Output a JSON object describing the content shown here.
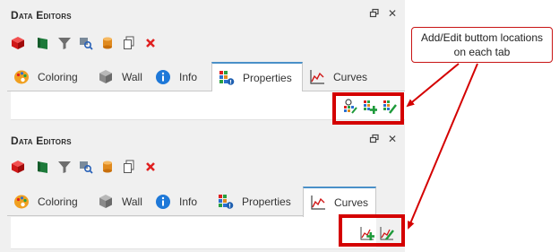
{
  "panels": [
    {
      "title": "Data Editors",
      "tabs": [
        {
          "label": "Coloring",
          "icon": "palette-icon",
          "active": false
        },
        {
          "label": "Wall",
          "icon": "wall-icon",
          "active": false
        },
        {
          "label": "Info",
          "icon": "info-icon",
          "active": false
        },
        {
          "label": "Properties",
          "icon": "properties-icon",
          "active": true
        },
        {
          "label": "Curves",
          "icon": "curves-icon",
          "active": false
        }
      ],
      "tab_tools": [
        "properties-search-icon",
        "properties-add-icon",
        "properties-edit-icon"
      ]
    },
    {
      "title": "Data Editors",
      "tabs": [
        {
          "label": "Coloring",
          "icon": "palette-icon",
          "active": false
        },
        {
          "label": "Wall",
          "icon": "wall-icon",
          "active": false
        },
        {
          "label": "Info",
          "icon": "info-icon",
          "active": false
        },
        {
          "label": "Properties",
          "icon": "properties-icon",
          "active": false
        },
        {
          "label": "Curves",
          "icon": "curves-icon",
          "active": true
        }
      ],
      "tab_tools": [
        "curve-add-icon",
        "curve-edit-icon"
      ]
    }
  ],
  "toolbar_icons": [
    "cube-icon",
    "flag-icon",
    "filter-icon",
    "zoom-icon",
    "cylinder-icon",
    "copy-icon",
    "delete-icon"
  ],
  "callout": {
    "line1": "Add/Edit buttom locations",
    "line2": "on each tab"
  },
  "colors": {
    "highlight": "#d40000",
    "panel_bg": "#f0f0f0",
    "active_tab_accent": "#4a90c8"
  }
}
